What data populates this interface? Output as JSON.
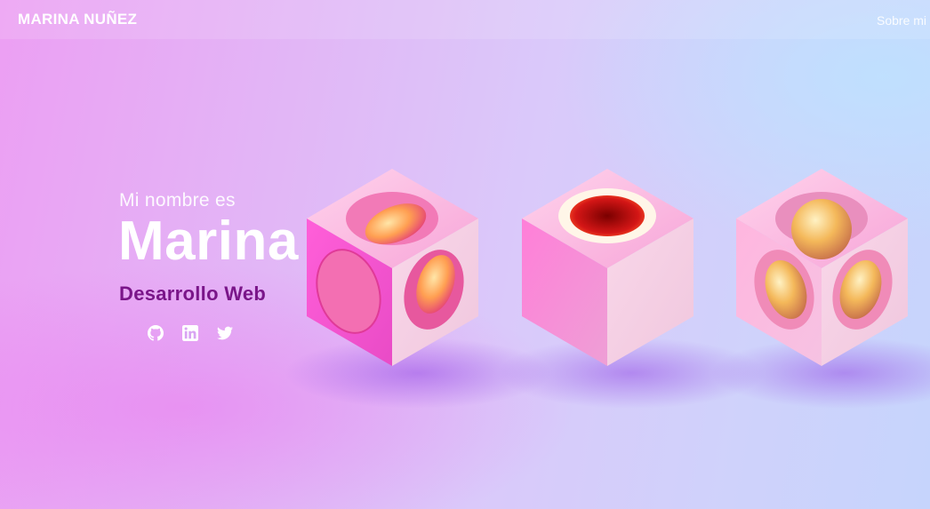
{
  "navbar": {
    "brand": "MARINA NUÑEZ",
    "links": [
      {
        "label": "Sobre mi"
      }
    ]
  },
  "hero": {
    "intro": "Mi nombre es",
    "name": "Marina",
    "role": "Desarrollo Web",
    "social": [
      {
        "icon": "github-icon"
      },
      {
        "icon": "linkedin-icon"
      },
      {
        "icon": "twitter-icon"
      }
    ]
  },
  "colors": {
    "brand_text": "#ffffff",
    "role_text": "#7a1589",
    "background_left": "#ec9ff3",
    "background_right": "#c6d4fc"
  }
}
